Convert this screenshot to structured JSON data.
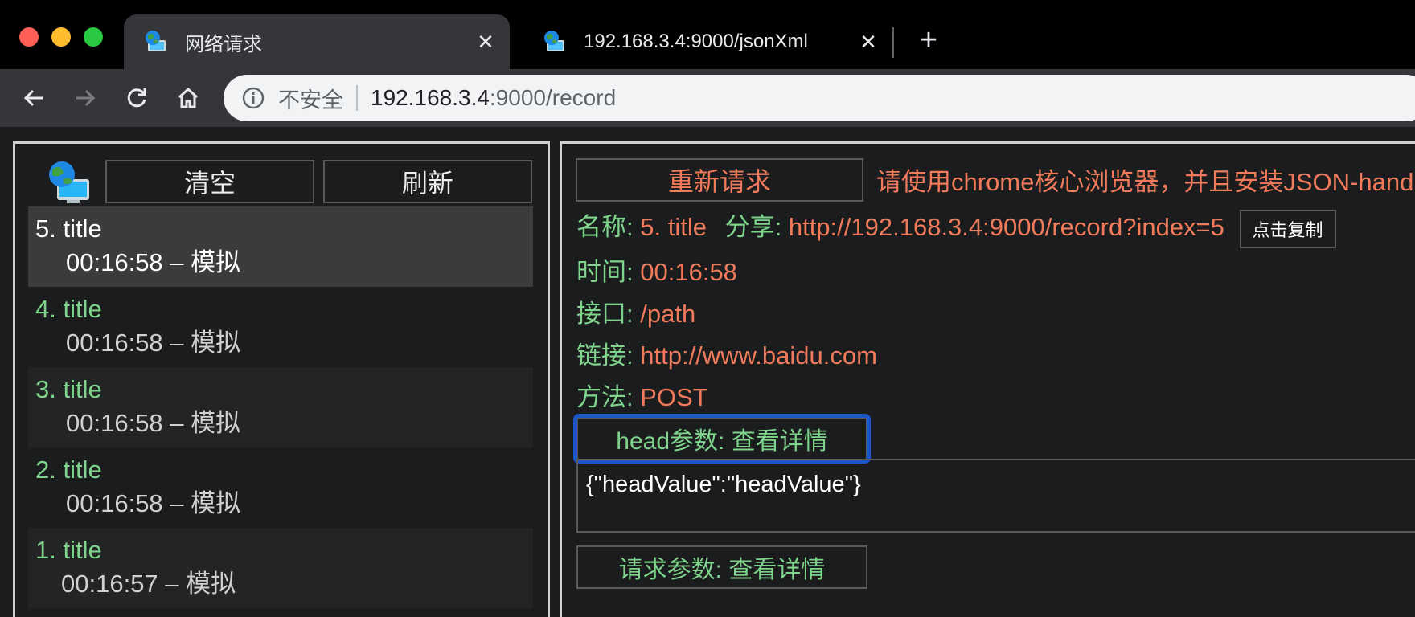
{
  "browser": {
    "tabs": [
      {
        "title": "网络请求",
        "active": true,
        "favicon": "globe-computer-icon"
      },
      {
        "title": "192.168.3.4:9000/jsonXml",
        "active": false,
        "favicon": "globe-computer-icon"
      }
    ],
    "new_tab_label": "+",
    "close_label": "✕",
    "address": {
      "security_text": "不安全",
      "url_host": "192.168.3.4",
      "url_rest": ":9000/record"
    }
  },
  "sidebar": {
    "clear_label": "清空",
    "refresh_label": "刷新",
    "records": [
      {
        "title": "5. title",
        "subtitle": "00:16:58 – 模拟",
        "selected": true
      },
      {
        "title": "4. title",
        "subtitle": "00:16:58 – 模拟",
        "selected": false
      },
      {
        "title": "3. title",
        "subtitle": "00:16:58 – 模拟",
        "selected": false
      },
      {
        "title": "2. title",
        "subtitle": "00:16:58 – 模拟",
        "selected": false
      },
      {
        "title": "1. title",
        "subtitle": "00:16:57 – 模拟",
        "selected": false
      }
    ]
  },
  "detail": {
    "resend_label": "重新请求",
    "notice": "请使用chrome核心浏览器，并且安装JSON-handle",
    "name_label": "名称:",
    "name_value": "5. title",
    "share_label": "分享:",
    "share_value": "http://192.168.3.4:9000/record?index=5",
    "copy_label": "点击复制",
    "time_label": "时间:",
    "time_value": "00:16:58",
    "path_label": "接口:",
    "path_value": "/path",
    "link_label": "链接:",
    "link_value": "http://www.baidu.com",
    "method_label": "方法:",
    "method_value": "POST",
    "head_button_label": "head参数: 查看详情",
    "head_value": "{\"headValue\":\"headValue\"}",
    "request_button_label": "请求参数: 查看详情"
  },
  "colors": {
    "label_green": "#7dd48a",
    "value_orange": "#f07a5a",
    "focus_blue": "#1a56c9",
    "background": "#1b1c1e"
  }
}
